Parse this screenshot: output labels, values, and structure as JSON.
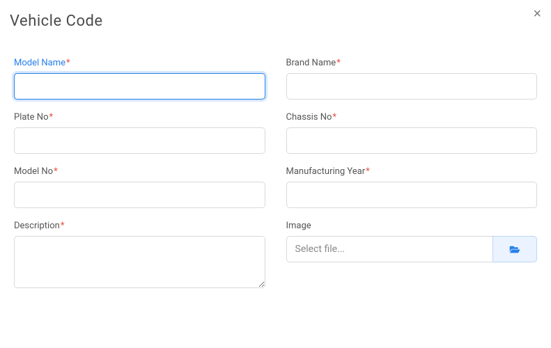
{
  "modal": {
    "title": "Vehicle Code"
  },
  "form": {
    "left": {
      "model_name": {
        "label": "Model Name",
        "value": "",
        "required": true
      },
      "plate_no": {
        "label": "Plate No",
        "value": "",
        "required": true
      },
      "model_no": {
        "label": "Model No",
        "value": "",
        "required": true
      },
      "description": {
        "label": "Description",
        "value": "",
        "required": true
      }
    },
    "right": {
      "brand_name": {
        "label": "Brand Name",
        "value": "",
        "required": true
      },
      "chassis_no": {
        "label": "Chassis No",
        "value": "",
        "required": true
      },
      "manufacturing_year": {
        "label": "Manufacturing Year",
        "value": "",
        "required": true
      },
      "image": {
        "label": "Image",
        "placeholder": "Select file...",
        "required": false
      }
    }
  },
  "required_marker": "*"
}
